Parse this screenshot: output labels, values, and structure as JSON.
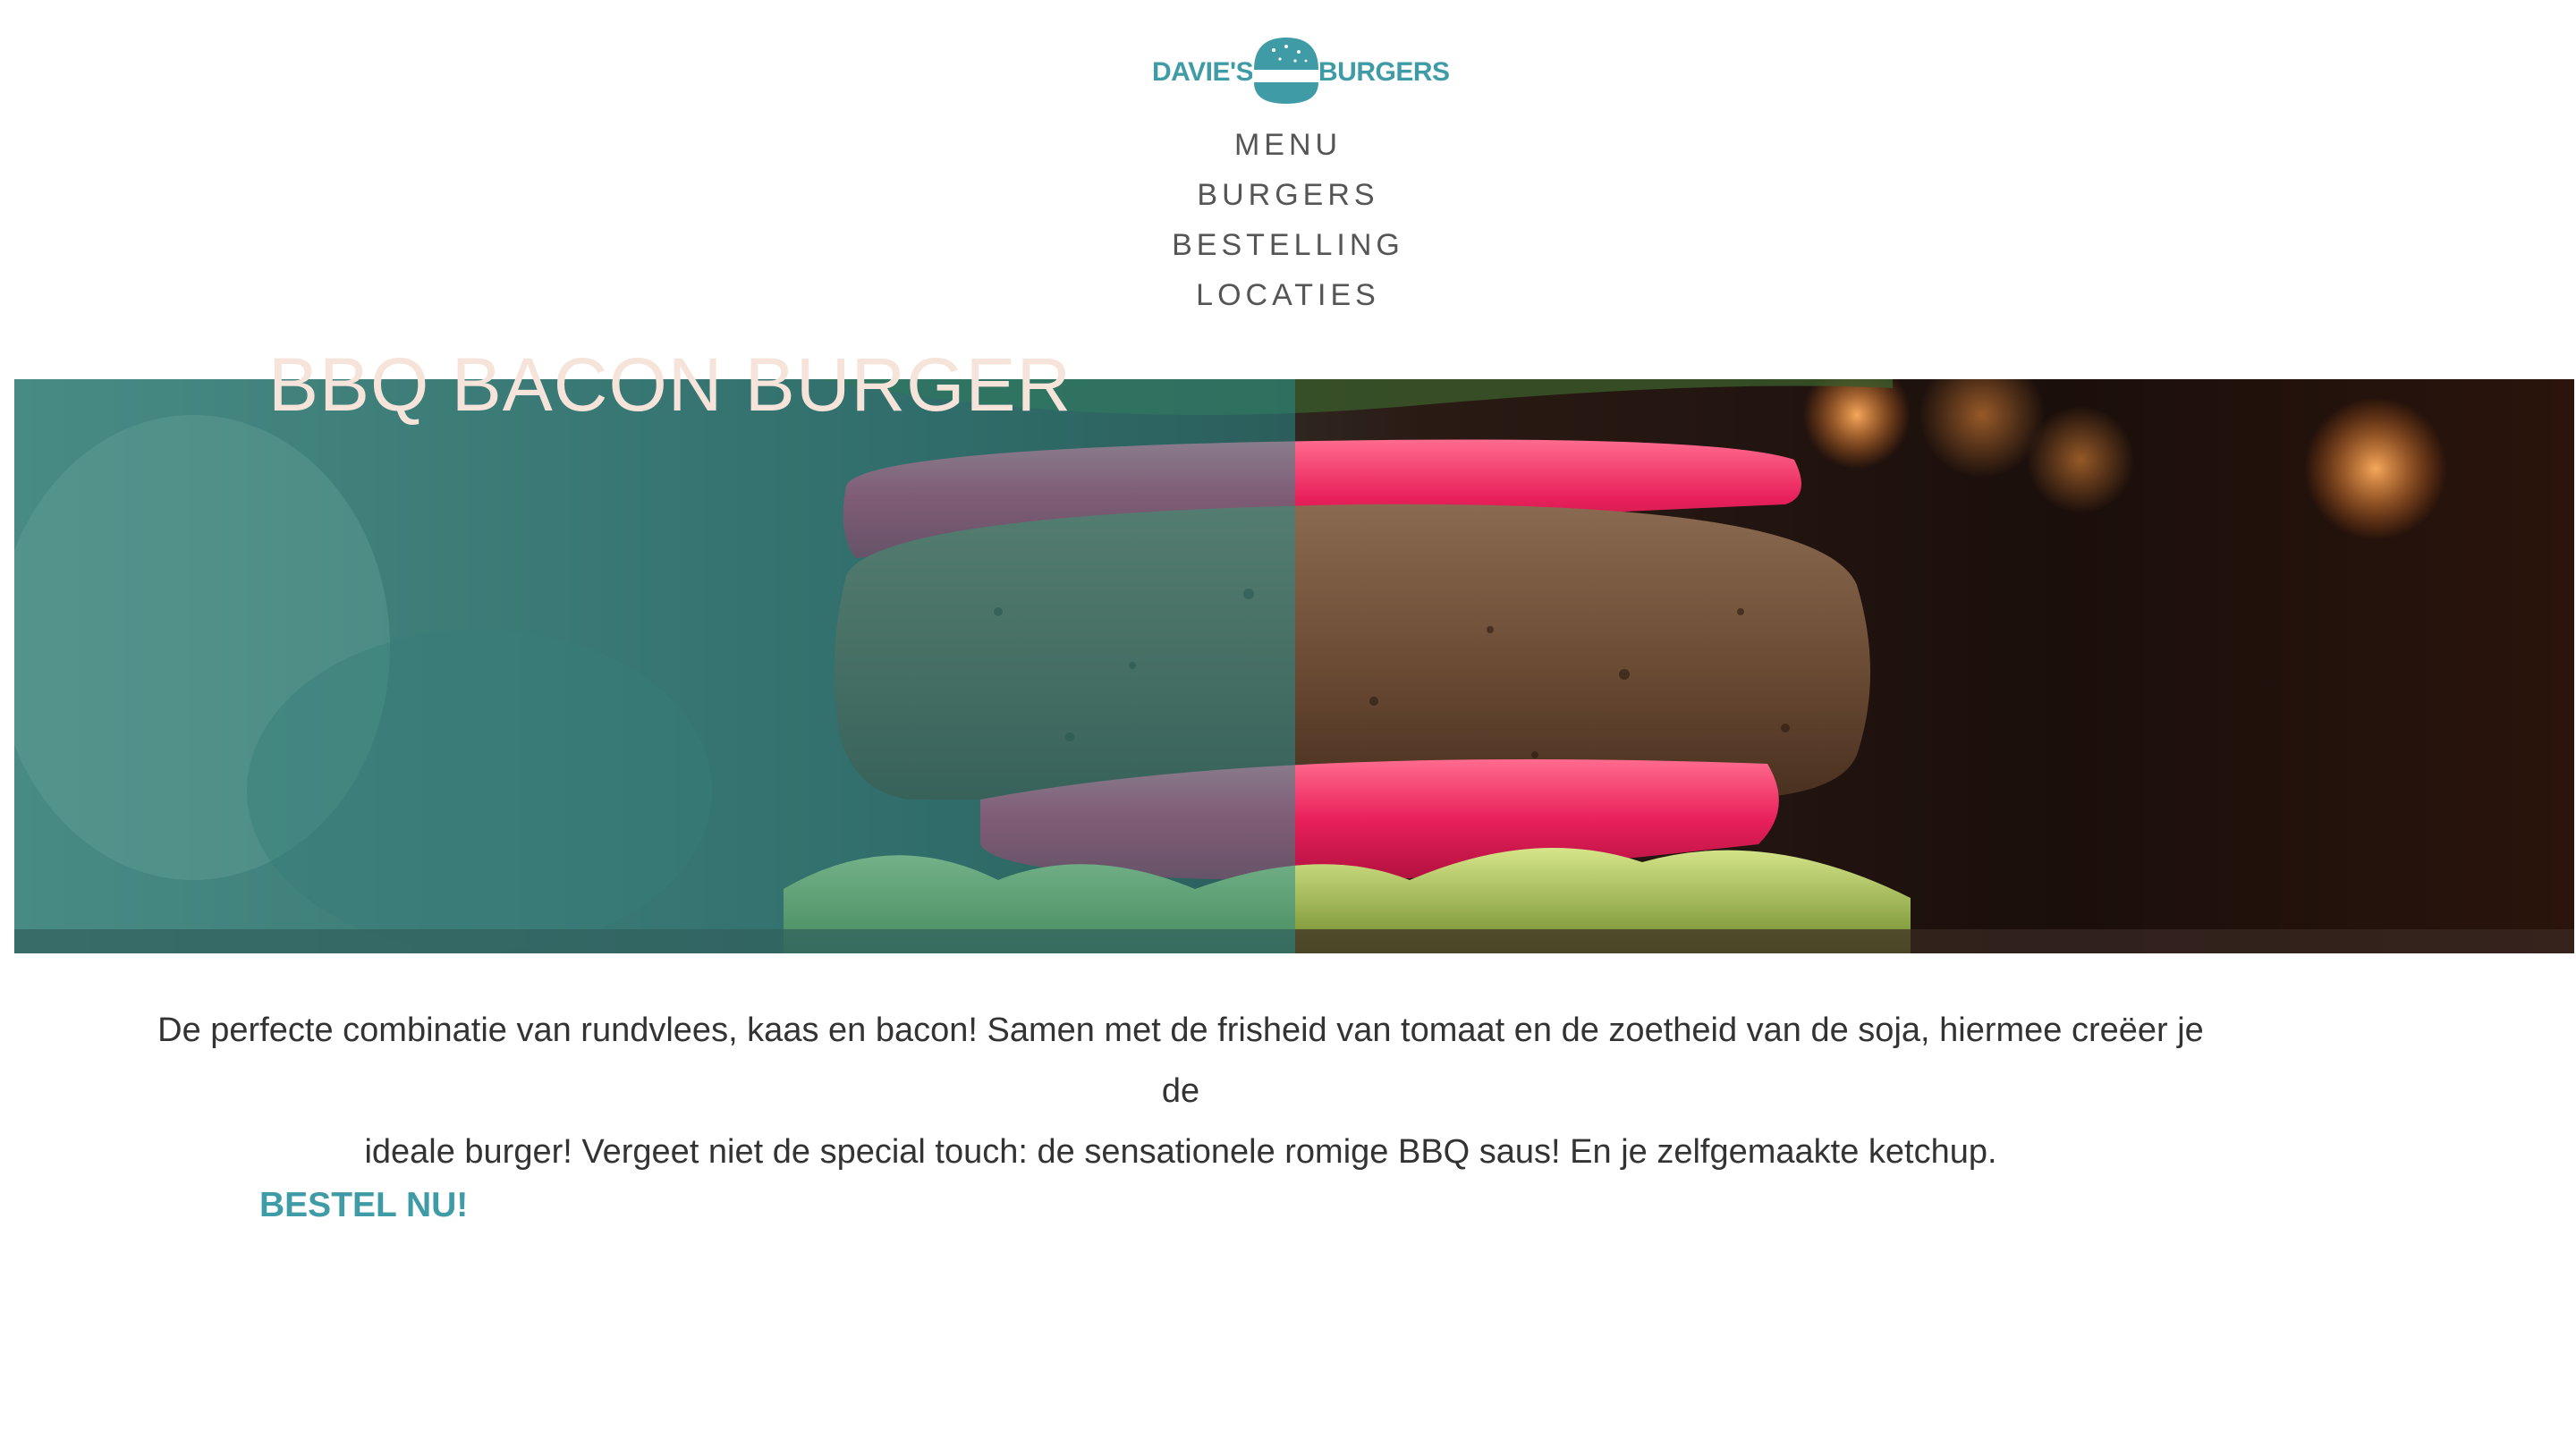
{
  "brand": {
    "left_word": "DAVIE'S",
    "right_word": "BURGERS",
    "color": "#3f9ba5",
    "icon": "burger-bun-icon"
  },
  "nav": {
    "items": [
      {
        "label": "MENU"
      },
      {
        "label": "BURGERS"
      },
      {
        "label": "BESTELLING"
      },
      {
        "label": "LOCATIES"
      }
    ]
  },
  "hero": {
    "title": "BBQ BACON BURGER",
    "overlay_color": "#288c8c"
  },
  "description": {
    "line1": "De perfecte combinatie van rundvlees, kaas en bacon! Samen met de frisheid van tomaat en de zoetheid van de soja, hiermee creëer je de",
    "line2": "ideale burger! Vergeet niet de special touch: de sensationele romige BBQ saus! En je zelfgemaakte ketchup."
  },
  "cta": {
    "label": "BESTEL NU!"
  }
}
